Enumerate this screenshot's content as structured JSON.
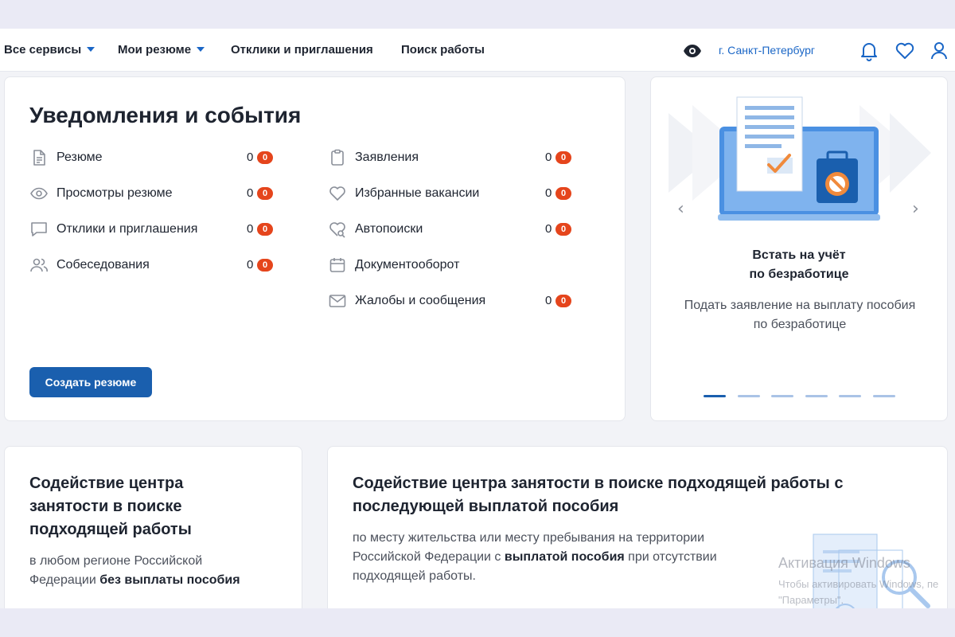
{
  "nav": {
    "all_services": "Все сервисы",
    "my_resume": "Мои резюме",
    "responses": "Отклики и приглашения",
    "job_search": "Поиск работы",
    "city": "г. Санкт-Петербург"
  },
  "notifications": {
    "title": "Уведомления и события",
    "left": [
      {
        "label": "Резюме",
        "count": "0",
        "badge": "0"
      },
      {
        "label": "Просмотры резюме",
        "count": "0",
        "badge": "0"
      },
      {
        "label": "Отклики и приглашения",
        "count": "0",
        "badge": "0"
      },
      {
        "label": "Собеседования",
        "count": "0",
        "badge": "0"
      }
    ],
    "right": [
      {
        "label": "Заявления",
        "count": "0",
        "badge": "0"
      },
      {
        "label": "Избранные вакансии",
        "count": "0",
        "badge": "0"
      },
      {
        "label": "Автопоиски",
        "count": "0",
        "badge": "0"
      },
      {
        "label": "Документооборот",
        "count": "",
        "badge": ""
      },
      {
        "label": "Жалобы и сообщения",
        "count": "0",
        "badge": "0"
      }
    ],
    "create_button": "Создать резюме"
  },
  "promo": {
    "title_line1": "Встать на учёт",
    "title_line2": "по безработице",
    "desc_line1": "Подать заявление на выплату пособия",
    "desc_line2": "по безработице",
    "prev": "‹",
    "next": "›",
    "slide_count": 6,
    "active_slide": 1
  },
  "bottom_left": {
    "title_line1": "Содействие центра",
    "title_line2": "занятости в поиске",
    "title_line3": "подходящей работы",
    "desc_line1": "в любом регионе Российской",
    "desc_plain": "Федерации ",
    "desc_bold": "без выплаты пособия"
  },
  "bottom_right": {
    "title_line1": "Содействие центра занятости в поиске подходящей работы с",
    "title_line2": "последующей выплатой пособия",
    "desc_line1": "по месту жительства или месту пребывания на территории",
    "desc_line2a": "Российской Федерации с ",
    "desc_line2b": "выплатой пособия",
    "desc_line2c": " при отсутствии",
    "desc_line3": "подходящей работы."
  },
  "watermark": {
    "line1": "Активация Windows",
    "line2": "Чтобы активировать Windows, пе",
    "line3": "\"Параметры\"."
  },
  "colors": {
    "accent": "#1a5fae",
    "link": "#1a66c6",
    "badge": "#e5451c",
    "illustration": "#4a90e2"
  },
  "icons": {
    "resume": "document-icon",
    "views": "eye-icon",
    "responses": "chat-icon",
    "interviews": "users-icon",
    "applications": "clipboard-icon",
    "favorites": "heart-icon",
    "autosearch": "heart-check-icon",
    "docflow": "calendar-icon",
    "complaints": "mail-icon"
  }
}
